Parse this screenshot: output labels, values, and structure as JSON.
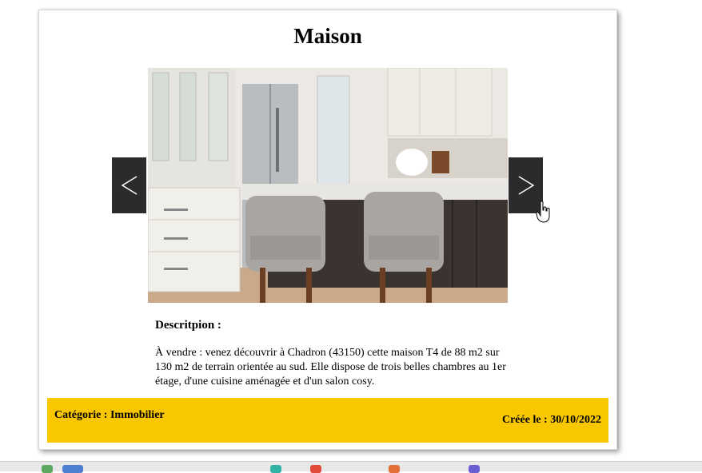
{
  "card": {
    "title": "Maison",
    "image_alt": "Kitchen with island and grey chairs",
    "carousel": {
      "prev_glyph": "<",
      "next_glyph": ">"
    },
    "description_heading": "Descritpion :",
    "description_text": "À vendre : venez découvrir à Chadron (43150) cette maison T4 de 88 m2 sur 130 m2 de terrain orientée au sud. Elle dispose de trois belles chambres au 1er étage, d'une cuisine aménagée et d'un salon cosy.",
    "category": "Catégorie : Immobilier",
    "created": "Créée le : 30/10/2022"
  },
  "colors": {
    "footer_bg": "#f8c700",
    "nav_bg": "#2b2b2b"
  }
}
